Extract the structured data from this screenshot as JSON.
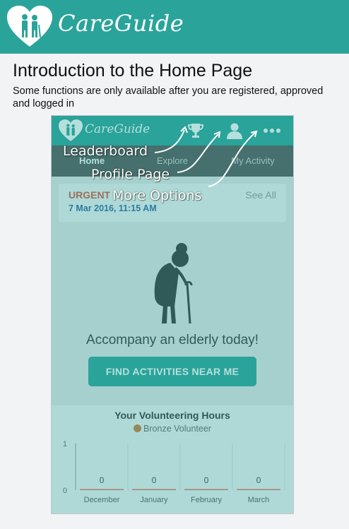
{
  "header": {
    "brand": "CareGuide"
  },
  "intro": {
    "title": "Introduction to the Home Page",
    "subtitle": "Some functions are only available after you are registered, approved and logged in"
  },
  "app": {
    "brand": "CareGuide",
    "icons": [
      "trophy-icon",
      "person-icon",
      "more-options-icon"
    ],
    "tabs": [
      {
        "label": "Home",
        "active": true
      },
      {
        "label": "Explore",
        "active": false
      },
      {
        "label": "My Activity",
        "active": false
      }
    ],
    "urgent": {
      "title": "URGENT",
      "date": "7 Mar 2016, 11:15 AM",
      "see_all": "See All"
    },
    "tagline": "Accompany an elderly today!",
    "cta": "FIND ACTIVITIES NEAR ME",
    "hours": {
      "title": "Your Volunteering Hours",
      "badge": "Bronze Volunteer"
    }
  },
  "callouts": {
    "leaderboard": "Leaderboard",
    "profile": "Profile Page",
    "more": "More Options"
  },
  "colors": {
    "brand": "#2aa49a",
    "urgent": "#d9533c",
    "date": "#2e67a8",
    "bar": "#e0716a"
  },
  "chart_data": {
    "type": "bar",
    "categories": [
      "December",
      "January",
      "February",
      "March"
    ],
    "values": [
      0,
      0,
      0,
      0
    ],
    "ylim": [
      0,
      1
    ],
    "yticks": [
      0,
      1
    ],
    "grid": true
  }
}
